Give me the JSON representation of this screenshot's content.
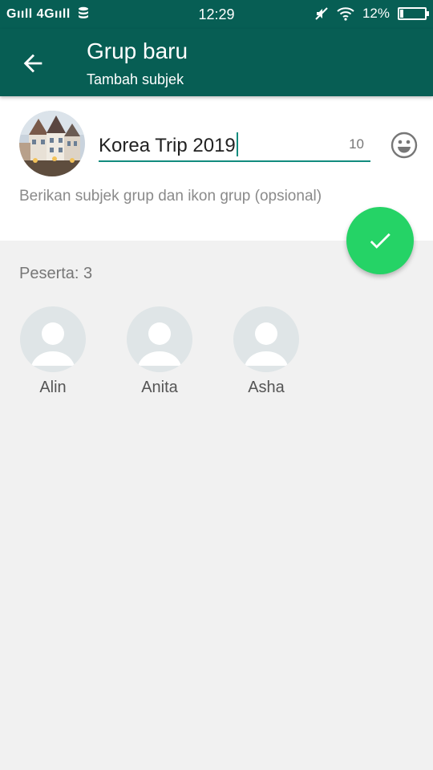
{
  "status_bar": {
    "signal": "Gııll 4Gııll",
    "time": "12:29",
    "battery": "12%"
  },
  "app_bar": {
    "title": "Grup baru",
    "subtitle": "Tambah subjek"
  },
  "group_form": {
    "name_value": "Korea Trip 2019",
    "char_counter": "10",
    "helper_text": "Berikan subjek grup dan ikon grup (opsional)"
  },
  "participants": {
    "label": "Peserta: 3",
    "members": [
      {
        "name": "Alin"
      },
      {
        "name": "Anita"
      },
      {
        "name": "Asha"
      }
    ]
  },
  "colors": {
    "primary_dark": "#075e54",
    "accent": "#128c7e",
    "fab": "#25d366"
  }
}
